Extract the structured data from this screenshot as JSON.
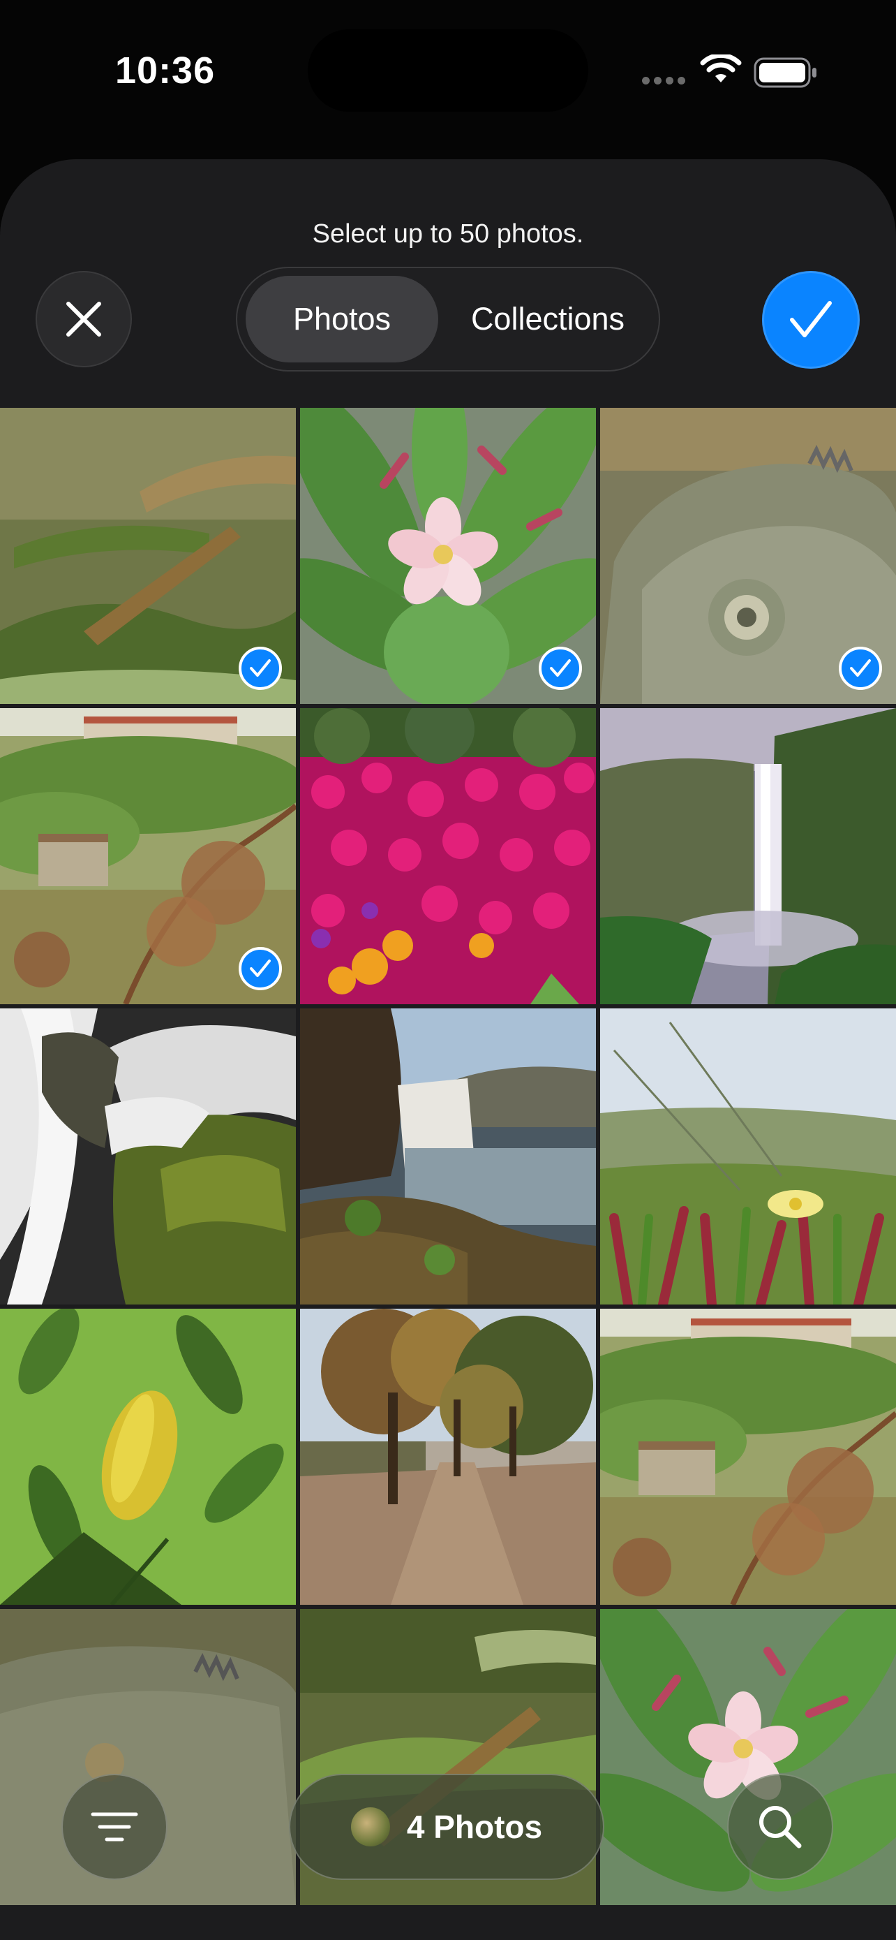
{
  "status_bar": {
    "time": "10:36"
  },
  "picker": {
    "title": "Select up to 50 photos.",
    "segments": [
      {
        "label": "Photos",
        "selected": true
      },
      {
        "label": "Collections",
        "selected": false
      }
    ]
  },
  "grid": {
    "photos": [
      {
        "subject": "blurred leaves",
        "selected": true
      },
      {
        "subject": "frangipani flower",
        "selected": true
      },
      {
        "subject": "iguana close-up",
        "selected": true
      },
      {
        "subject": "countryside house",
        "selected": true
      },
      {
        "subject": "magenta flowers",
        "selected": false
      },
      {
        "subject": "waterfall cliff",
        "selected": false
      },
      {
        "subject": "waterfall rocks",
        "selected": false
      },
      {
        "subject": "waterfall lake",
        "selected": false
      },
      {
        "subject": "ice plant flower",
        "selected": false
      },
      {
        "subject": "yellow leaf",
        "selected": false
      },
      {
        "subject": "autumn trees path",
        "selected": false
      },
      {
        "subject": "countryside house",
        "selected": false
      },
      {
        "subject": "iguana close-up",
        "selected": false
      },
      {
        "subject": "blurred leaves",
        "selected": false
      },
      {
        "subject": "frangipani flower",
        "selected": false
      }
    ]
  },
  "bottom_bar": {
    "selection_label": "4 Photos"
  },
  "colors": {
    "accent": "#0a84ff",
    "sheet_background": "#1c1c1e"
  }
}
